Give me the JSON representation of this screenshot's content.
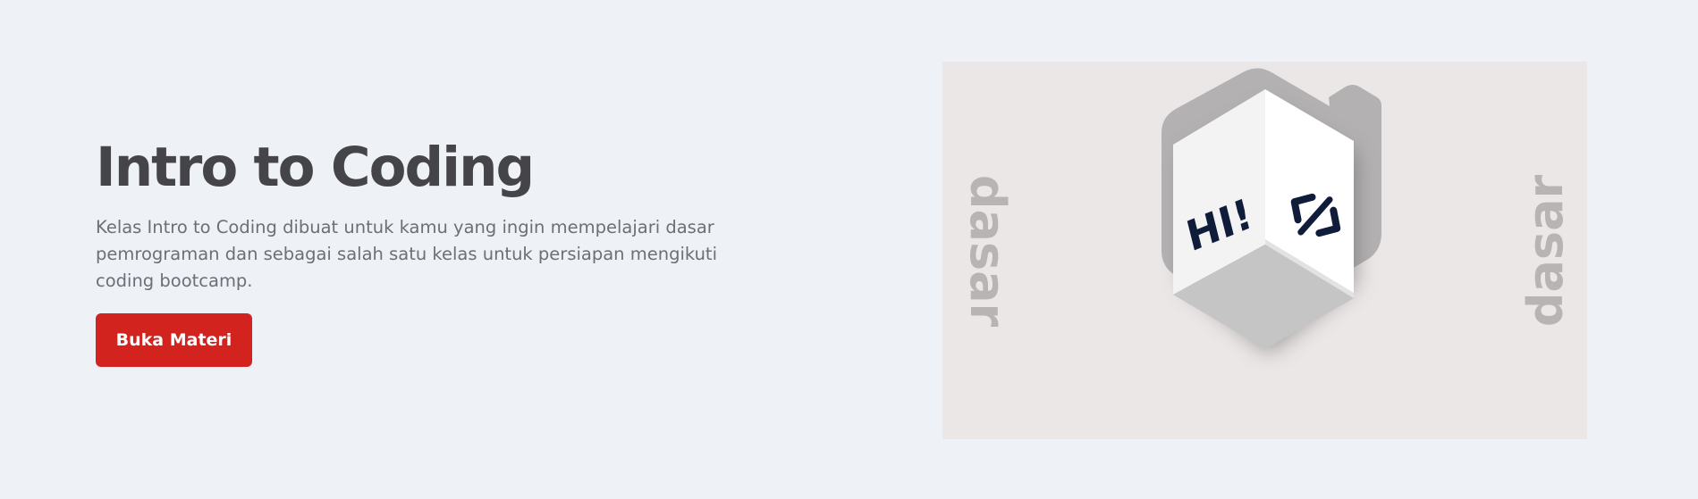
{
  "hero": {
    "title": "Intro to Coding",
    "description": "Kelas Intro to Coding dibuat untuk kamu yang ingin mempelajari dasar pemrograman dan sebagai salah satu kelas untuk persiapan mengikuti coding bootcamp.",
    "cta_label": "Buka Materi"
  },
  "media": {
    "side_word_left": "dasar",
    "side_word_right": "dasar",
    "cube_left_face_text": "HI!",
    "cube_right_face_icon": "code-brackets-icon"
  },
  "colors": {
    "page_background": "#eef1f6",
    "title": "#454549",
    "body_text": "#6b6f78",
    "accent_button": "#d2231f",
    "media_background": "#ebe7e6",
    "cube_ink": "#0f1d3a"
  }
}
